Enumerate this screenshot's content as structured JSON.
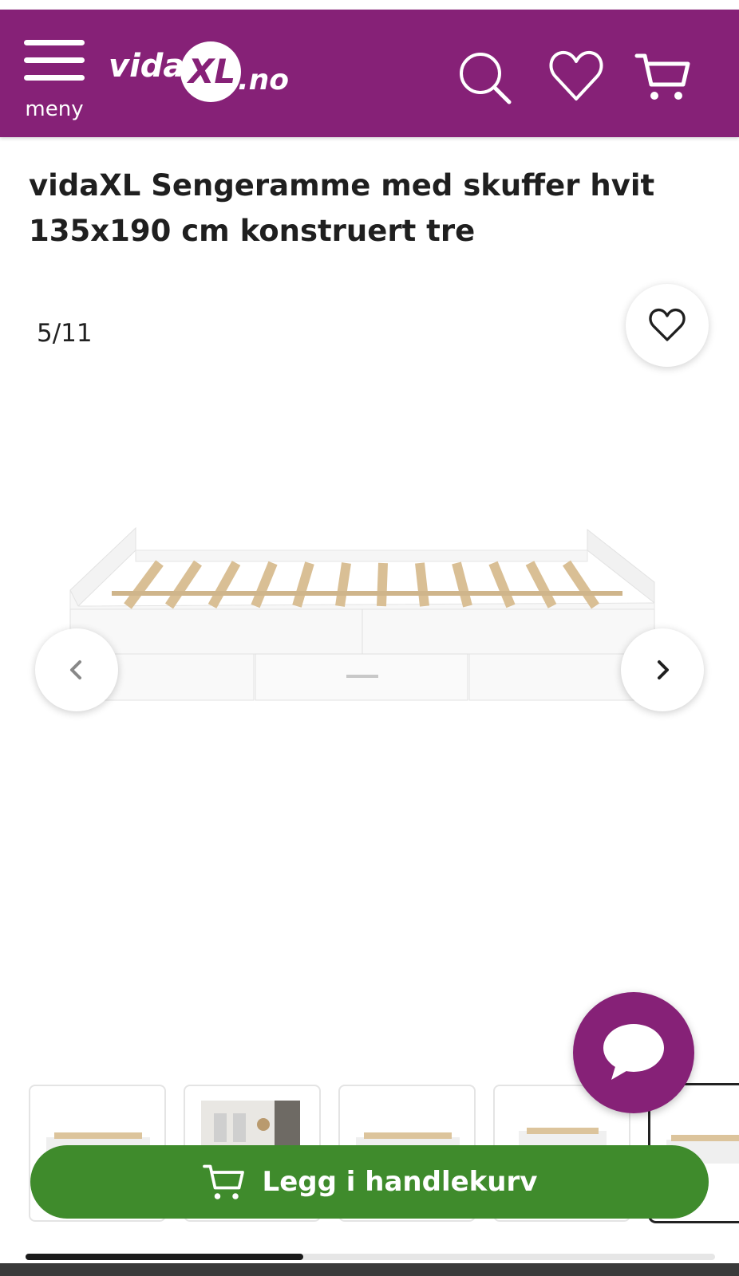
{
  "header": {
    "menu_label": "meny",
    "logo_text_main": "vidaXL",
    "logo_text_domain": ".no",
    "icons": [
      "menu-icon",
      "search-icon",
      "heart-icon",
      "cart-icon"
    ],
    "background_color": "#862177"
  },
  "product": {
    "title_line1": "vidaXL Sengeramme med skuffer hvit",
    "title_line2": "135x190 cm konstruert tre"
  },
  "gallery": {
    "counter": "5/11",
    "current": 5,
    "total": 11
  },
  "actions": {
    "add_to_cart_label": "Legg i handlekurv",
    "add_to_cart_color": "#3f8b2c",
    "chat_color": "#862177"
  }
}
